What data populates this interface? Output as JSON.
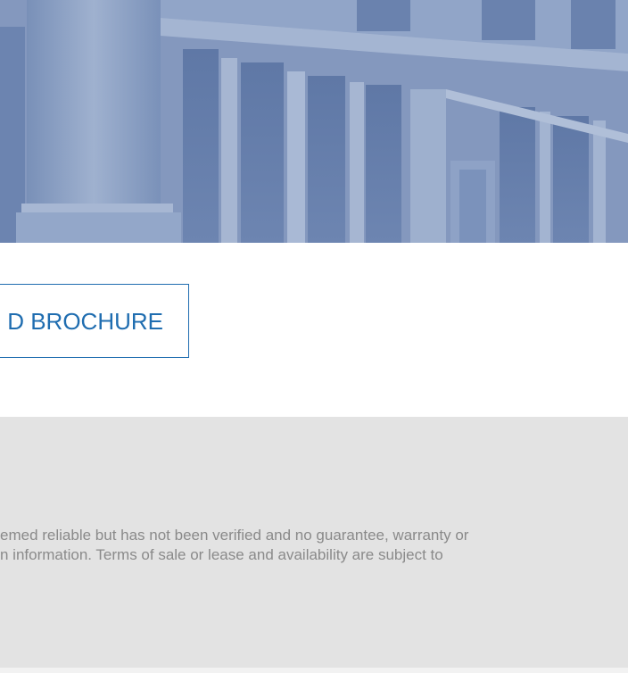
{
  "hero": {
    "image_description_icon": "building-facade-image",
    "tint_color": "#7f96bd"
  },
  "brochure_button": {
    "label": "DOWNLOAD BROCHURE",
    "visible_label": "D BROCHURE",
    "color": "#1f6db0"
  },
  "disclaimer": {
    "line1": "emed reliable but has not been verified and no guarantee, warranty or",
    "line2": "n information. Terms of sale or lease and availability are subject to",
    "background": "#e3e3e3",
    "text_color": "#8a8a8a"
  }
}
